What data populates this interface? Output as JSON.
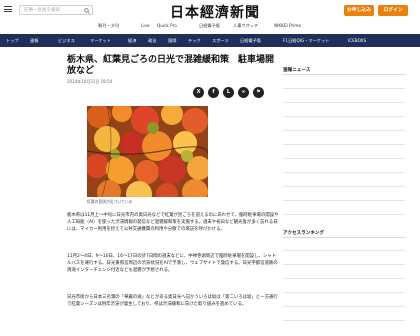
{
  "header": {
    "search_placeholder": "記事・会員を検索",
    "logo": "日本經濟新聞",
    "signup_label": "お申し込み",
    "login_label": "ログイン"
  },
  "subnav": [
    "朝刊・夕刊",
    "Live",
    "Quick Pro",
    "日経電子版",
    "人事ウオッチ",
    "NIKKEI Prime"
  ],
  "mainnav": [
    "トップ",
    "速報",
    "ビジネス",
    "マーケット",
    "経済",
    "政治",
    "国際",
    "テック",
    "スポーツ",
    "日経電子版",
    "F1日経QIG・マーケット",
    "ICEBOXS"
  ],
  "article": {
    "headline": "栃木県、紅葉見ごろの日光で混雑緩和策　駐車場開放など",
    "date": "2024年10月31日 19:54",
    "photo_caption": "紅葉の見頃が近づいている",
    "paragraphs": [
      "栃木県は11月上〜中旬に日光市内の奥日光などで紅葉が見ごろを迎えるのにあわせて、臨時駐車場の開設や人工知能（AI）を使った渋滞情報の発信など混雑緩和策を実施する。週末や祝日など観光客が多く訪れる日には、マイカー利用を控えて公共交通機関の利用や分散での来訪を呼びかける。",
      "11月2〜4日、9〜10日、16〜17日の計7日間の週末などに、中禅寺湖周辺で臨時駐車場を開設し、シャトルバスを運行する。日光東照宮周辺の渋滞状況をAIで予測し、ウェブサイトで発信する。日光宇都宮道路の清滝インターチェンジ付近なども混雑が予想される。",
      "日光市街から日本三名瀑の「華厳の滝」などがある奥日光へ向かういろは坂は「第二いろは坂」と一方通行で紅葉シーズンは例年渋滞が発生しており、県は渋滞緩和に向けた取り組みを進めている。"
    ]
  },
  "sidebar": {
    "headings": [
      "速報ニュース",
      "アクセスランキング"
    ],
    "items": [
      "●"
    ]
  },
  "share_icons": [
    "x-icon",
    "facebook-icon",
    "line-icon",
    "link-icon",
    "bookmark-icon"
  ],
  "colors": {
    "accent": "#e8820c",
    "nav": "#1f2f5a"
  }
}
